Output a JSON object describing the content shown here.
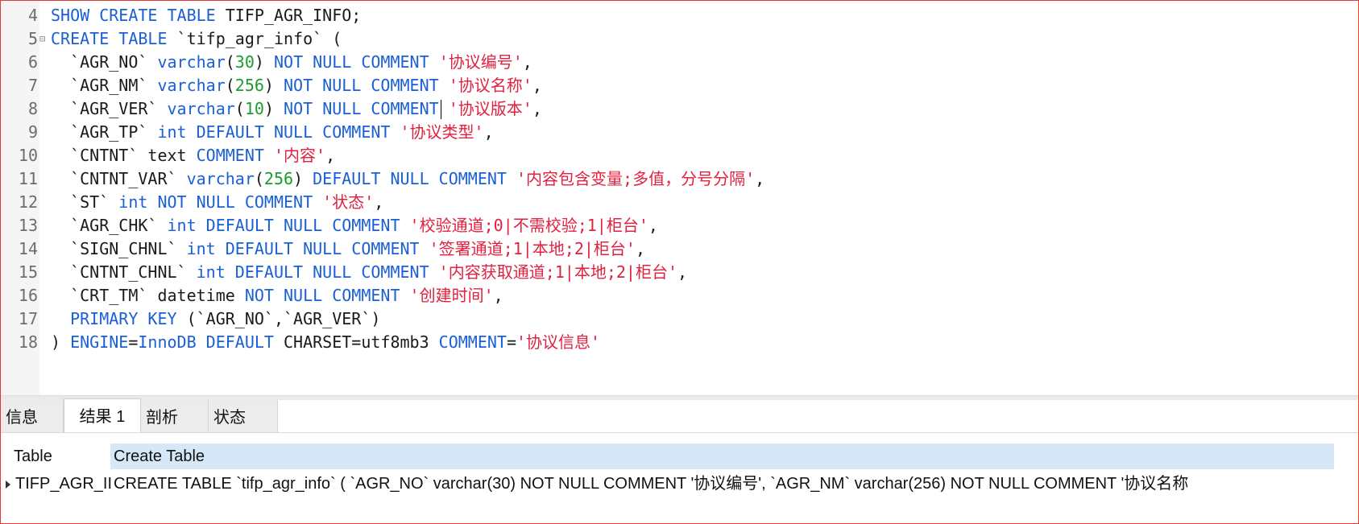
{
  "editor": {
    "lines": [
      {
        "num": "4",
        "fold": "",
        "tokens": [
          {
            "t": "kw",
            "v": "SHOW CREATE TABLE"
          },
          {
            "t": "pl",
            "v": " TIFP_AGR_INFO;"
          }
        ]
      },
      {
        "num": "5",
        "fold": "⊟",
        "tokens": [
          {
            "t": "kw",
            "v": "CREATE TABLE"
          },
          {
            "t": "pl",
            "v": " `tifp_agr_info` ("
          }
        ]
      },
      {
        "num": "6",
        "fold": "",
        "tokens": [
          {
            "t": "pl",
            "v": "  `AGR_NO` "
          },
          {
            "t": "kw",
            "v": "varchar"
          },
          {
            "t": "pl",
            "v": "("
          },
          {
            "t": "num",
            "v": "30"
          },
          {
            "t": "pl",
            "v": ") "
          },
          {
            "t": "kw",
            "v": "NOT NULL COMMENT"
          },
          {
            "t": "pl",
            "v": " "
          },
          {
            "t": "str",
            "v": "'协议编号'"
          },
          {
            "t": "pl",
            "v": ","
          }
        ]
      },
      {
        "num": "7",
        "fold": "",
        "tokens": [
          {
            "t": "pl",
            "v": "  `AGR_NM` "
          },
          {
            "t": "kw",
            "v": "varchar"
          },
          {
            "t": "pl",
            "v": "("
          },
          {
            "t": "num",
            "v": "256"
          },
          {
            "t": "pl",
            "v": ") "
          },
          {
            "t": "kw",
            "v": "NOT NULL COMMENT"
          },
          {
            "t": "pl",
            "v": " "
          },
          {
            "t": "str",
            "v": "'协议名称'"
          },
          {
            "t": "pl",
            "v": ","
          }
        ]
      },
      {
        "num": "8",
        "fold": "",
        "tokens": [
          {
            "t": "pl",
            "v": "  `AGR_VER` "
          },
          {
            "t": "kw",
            "v": "varchar"
          },
          {
            "t": "pl",
            "v": "("
          },
          {
            "t": "num",
            "v": "10"
          },
          {
            "t": "pl",
            "v": ") "
          },
          {
            "t": "kw",
            "v": "NOT NULL COMMENT"
          },
          {
            "t": "pl",
            "v": " "
          },
          {
            "t": "str",
            "v": "'协议版本'"
          },
          {
            "t": "pl",
            "v": ","
          }
        ]
      },
      {
        "num": "9",
        "fold": "",
        "tokens": [
          {
            "t": "pl",
            "v": "  `AGR_TP` "
          },
          {
            "t": "kw",
            "v": "int DEFAULT NULL COMMENT"
          },
          {
            "t": "pl",
            "v": " "
          },
          {
            "t": "str",
            "v": "'协议类型'"
          },
          {
            "t": "pl",
            "v": ","
          }
        ]
      },
      {
        "num": "10",
        "fold": "",
        "tokens": [
          {
            "t": "pl",
            "v": "  `CNTNT` text "
          },
          {
            "t": "kw",
            "v": "COMMENT"
          },
          {
            "t": "pl",
            "v": " "
          },
          {
            "t": "str",
            "v": "'内容'"
          },
          {
            "t": "pl",
            "v": ","
          }
        ]
      },
      {
        "num": "11",
        "fold": "",
        "tokens": [
          {
            "t": "pl",
            "v": "  `CNTNT_VAR` "
          },
          {
            "t": "kw",
            "v": "varchar"
          },
          {
            "t": "pl",
            "v": "("
          },
          {
            "t": "num",
            "v": "256"
          },
          {
            "t": "pl",
            "v": ") "
          },
          {
            "t": "kw",
            "v": "DEFAULT NULL COMMENT"
          },
          {
            "t": "pl",
            "v": " "
          },
          {
            "t": "str",
            "v": "'内容包含变量;多值，分号分隔'"
          },
          {
            "t": "pl",
            "v": ","
          }
        ]
      },
      {
        "num": "12",
        "fold": "",
        "tokens": [
          {
            "t": "pl",
            "v": "  `ST` "
          },
          {
            "t": "kw",
            "v": "int NOT NULL COMMENT"
          },
          {
            "t": "pl",
            "v": " "
          },
          {
            "t": "str",
            "v": "'状态'"
          },
          {
            "t": "pl",
            "v": ","
          }
        ]
      },
      {
        "num": "13",
        "fold": "",
        "tokens": [
          {
            "t": "pl",
            "v": "  `AGR_CHK` "
          },
          {
            "t": "kw",
            "v": "int DEFAULT NULL COMMENT"
          },
          {
            "t": "pl",
            "v": " "
          },
          {
            "t": "str",
            "v": "'校验通道;0|不需校验;1|柜台'"
          },
          {
            "t": "pl",
            "v": ","
          }
        ]
      },
      {
        "num": "14",
        "fold": "",
        "tokens": [
          {
            "t": "pl",
            "v": "  `SIGN_CHNL` "
          },
          {
            "t": "kw",
            "v": "int DEFAULT NULL COMMENT"
          },
          {
            "t": "pl",
            "v": " "
          },
          {
            "t": "str",
            "v": "'签署通道;1|本地;2|柜台'"
          },
          {
            "t": "pl",
            "v": ","
          }
        ]
      },
      {
        "num": "15",
        "fold": "",
        "tokens": [
          {
            "t": "pl",
            "v": "  `CNTNT_CHNL` "
          },
          {
            "t": "kw",
            "v": "int DEFAULT NULL COMMENT"
          },
          {
            "t": "pl",
            "v": " "
          },
          {
            "t": "str",
            "v": "'内容获取通道;1|本地;2|柜台'"
          },
          {
            "t": "pl",
            "v": ","
          }
        ]
      },
      {
        "num": "16",
        "fold": "",
        "tokens": [
          {
            "t": "pl",
            "v": "  `CRT_TM` datetime "
          },
          {
            "t": "kw",
            "v": "NOT NULL COMMENT"
          },
          {
            "t": "pl",
            "v": " "
          },
          {
            "t": "str",
            "v": "'创建时间'"
          },
          {
            "t": "pl",
            "v": ","
          }
        ]
      },
      {
        "num": "17",
        "fold": "",
        "tokens": [
          {
            "t": "pl",
            "v": "  "
          },
          {
            "t": "kw",
            "v": "PRIMARY KEY"
          },
          {
            "t": "pl",
            "v": " (`AGR_NO`,`AGR_VER`)"
          }
        ]
      },
      {
        "num": "18",
        "fold": "",
        "tokens": [
          {
            "t": "pl",
            "v": ") "
          },
          {
            "t": "kw",
            "v": "ENGINE"
          },
          {
            "t": "pl",
            "v": "="
          },
          {
            "t": "kw",
            "v": "InnoDB DEFAULT"
          },
          {
            "t": "pl",
            "v": " CHARSET=utf8mb3 "
          },
          {
            "t": "kw",
            "v": "COMMENT"
          },
          {
            "t": "pl",
            "v": "="
          },
          {
            "t": "str",
            "v": "'协议信息'"
          }
        ]
      }
    ]
  },
  "tabs": [
    {
      "label": "信息",
      "active": false
    },
    {
      "label": "结果 1",
      "active": true
    },
    {
      "label": "剖析",
      "active": false
    },
    {
      "label": "状态",
      "active": false
    }
  ],
  "grid": {
    "columns": [
      "Table",
      "Create Table"
    ],
    "rows": [
      [
        "TIFP_AGR_II",
        "CREATE TABLE `tifp_agr_info` (  `AGR_NO` varchar(30) NOT NULL COMMENT '协议编号',  `AGR_NM` varchar(256) NOT NULL COMMENT '协议名称"
      ]
    ]
  },
  "colors": {
    "keyword": "#1a5fd6",
    "number": "#1b9c2e",
    "string": "#e0213f",
    "plain": "#1a1a1a",
    "header_highlight": "#d6e7f7",
    "frame_border": "#e53935"
  }
}
